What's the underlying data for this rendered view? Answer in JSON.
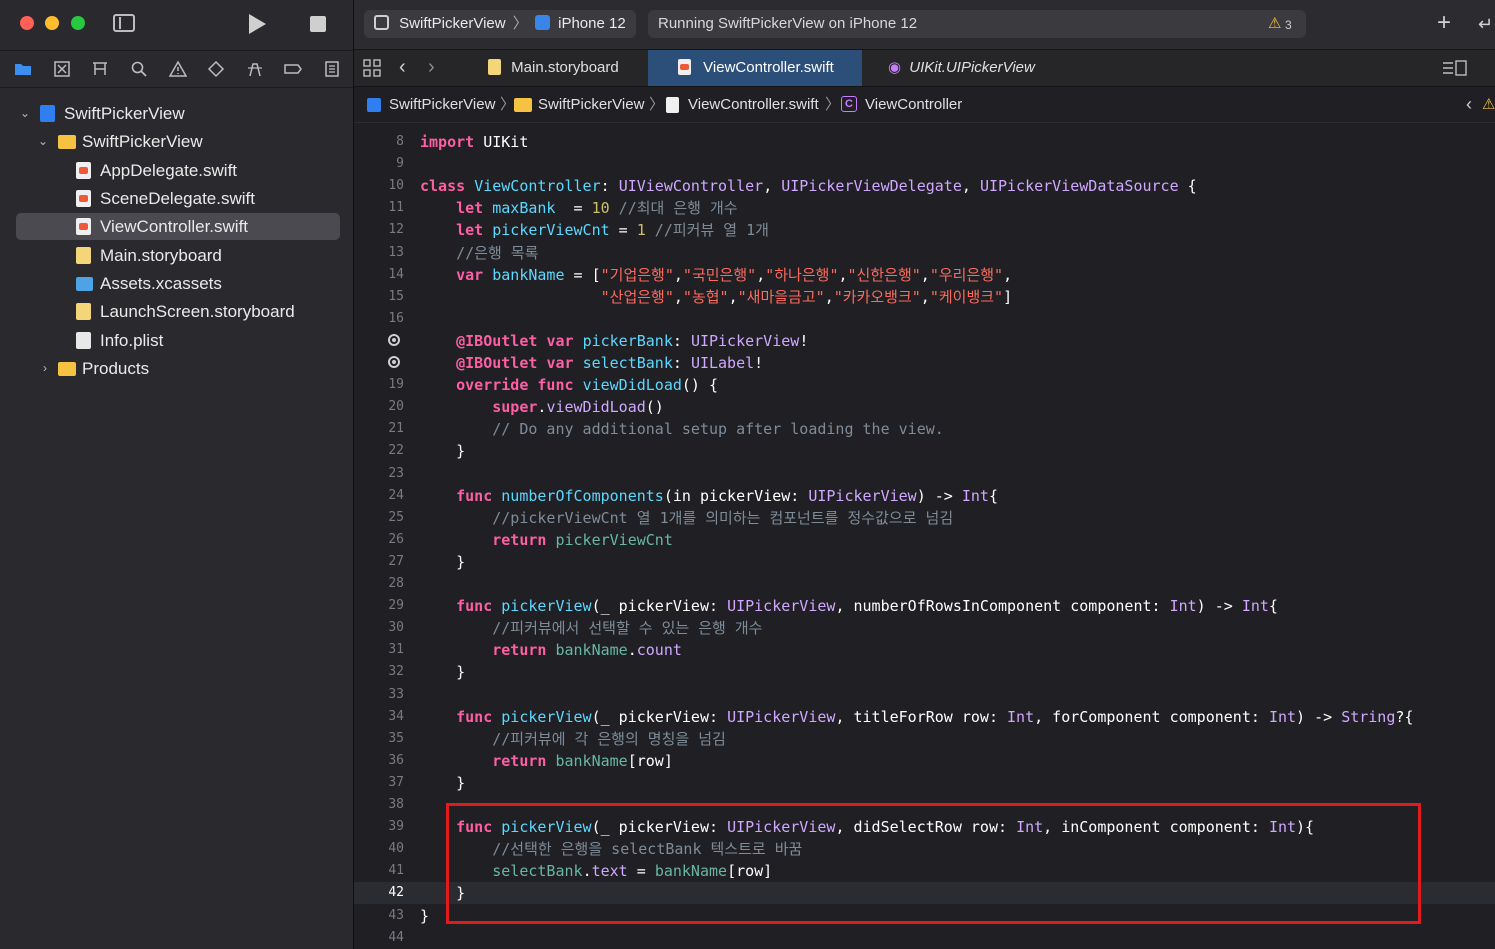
{
  "toolbar": {
    "scheme_target": "SwiftPickerView",
    "scheme_device": "iPhone 12",
    "status_text": "Running SwiftPickerView on iPhone 12",
    "warning_count": "3"
  },
  "tabs": [
    {
      "label": "Main.storyboard"
    },
    {
      "label": "ViewController.swift"
    },
    {
      "label": "UIKit.UIPickerView"
    }
  ],
  "jumpbar": {
    "project": "SwiftPickerView",
    "group": "SwiftPickerView",
    "file": "ViewController.swift",
    "symbol": "ViewController"
  },
  "navigator": {
    "project": "SwiftPickerView",
    "group": "SwiftPickerView",
    "files": [
      {
        "label": "AppDelegate.swift"
      },
      {
        "label": "SceneDelegate.swift"
      },
      {
        "label": "ViewController.swift"
      },
      {
        "label": "Main.storyboard"
      },
      {
        "label": "Assets.xcassets"
      },
      {
        "label": "LaunchScreen.storyboard"
      },
      {
        "label": "Info.plist"
      }
    ],
    "products": "Products"
  },
  "colors": {
    "keyword": "#fc5fa3",
    "type": "#d0a8ff",
    "declaration": "#5dd8ff",
    "member": "#67b7a4",
    "number": "#d0bf69",
    "string": "#fc6a5d",
    "comment": "#7f8c98",
    "highlight_box": "#e11b1b",
    "tab_active": "#2c4f7a"
  },
  "code": {
    "current_line": "42",
    "lines": [
      {
        "n": "8",
        "segments": [
          {
            "t": "import",
            "c": "kw"
          },
          {
            "t": " UIKit",
            "c": "pl"
          }
        ]
      },
      {
        "n": "9",
        "segments": []
      },
      {
        "n": "10",
        "segments": [
          {
            "t": "class",
            "c": "kw"
          },
          {
            "t": " ",
            "c": "pl"
          },
          {
            "t": "ViewController",
            "c": "dec"
          },
          {
            "t": ": ",
            "c": "pl"
          },
          {
            "t": "UIViewController",
            "c": "typ"
          },
          {
            "t": ", ",
            "c": "pl"
          },
          {
            "t": "UIPickerViewDelegate",
            "c": "typ"
          },
          {
            "t": ", ",
            "c": "pl"
          },
          {
            "t": "UIPickerViewDataSource",
            "c": "typ"
          },
          {
            "t": " {",
            "c": "pl"
          }
        ]
      },
      {
        "n": "11",
        "segments": [
          {
            "t": "    ",
            "c": "pl"
          },
          {
            "t": "let",
            "c": "kw"
          },
          {
            "t": " ",
            "c": "pl"
          },
          {
            "t": "maxBank",
            "c": "dec"
          },
          {
            "t": "  = ",
            "c": "pl"
          },
          {
            "t": "10",
            "c": "num"
          },
          {
            "t": " //최대 은행 개수",
            "c": "com"
          }
        ]
      },
      {
        "n": "12",
        "segments": [
          {
            "t": "    ",
            "c": "pl"
          },
          {
            "t": "let",
            "c": "kw"
          },
          {
            "t": " ",
            "c": "pl"
          },
          {
            "t": "pickerViewCnt",
            "c": "dec"
          },
          {
            "t": " = ",
            "c": "pl"
          },
          {
            "t": "1",
            "c": "num"
          },
          {
            "t": " //피커뷰 열 1개",
            "c": "com"
          }
        ]
      },
      {
        "n": "13",
        "segments": [
          {
            "t": "    //은행 목록",
            "c": "com"
          }
        ]
      },
      {
        "n": "14",
        "segments": [
          {
            "t": "    ",
            "c": "pl"
          },
          {
            "t": "var",
            "c": "kw"
          },
          {
            "t": " ",
            "c": "pl"
          },
          {
            "t": "bankName",
            "c": "dec"
          },
          {
            "t": " = [",
            "c": "pl"
          },
          {
            "t": "\"기업은행\"",
            "c": "str"
          },
          {
            "t": ",",
            "c": "pl"
          },
          {
            "t": "\"국민은행\"",
            "c": "str"
          },
          {
            "t": ",",
            "c": "pl"
          },
          {
            "t": "\"하나은행\"",
            "c": "str"
          },
          {
            "t": ",",
            "c": "pl"
          },
          {
            "t": "\"신한은행\"",
            "c": "str"
          },
          {
            "t": ",",
            "c": "pl"
          },
          {
            "t": "\"우리은행\"",
            "c": "str"
          },
          {
            "t": ",",
            "c": "pl"
          }
        ]
      },
      {
        "n": "15",
        "segments": [
          {
            "t": "                    ",
            "c": "pl"
          },
          {
            "t": "\"산업은행\"",
            "c": "str"
          },
          {
            "t": ",",
            "c": "pl"
          },
          {
            "t": "\"농협\"",
            "c": "str"
          },
          {
            "t": ",",
            "c": "pl"
          },
          {
            "t": "\"새마을금고\"",
            "c": "str"
          },
          {
            "t": ",",
            "c": "pl"
          },
          {
            "t": "\"카카오뱅크\"",
            "c": "str"
          },
          {
            "t": ",",
            "c": "pl"
          },
          {
            "t": "\"케이뱅크\"",
            "c": "str"
          },
          {
            "t": "]",
            "c": "pl"
          }
        ]
      },
      {
        "n": "16",
        "segments": []
      },
      {
        "n": "",
        "bp": true,
        "segments": [
          {
            "t": "    ",
            "c": "pl"
          },
          {
            "t": "@IBOutlet",
            "c": "kw"
          },
          {
            "t": " ",
            "c": "pl"
          },
          {
            "t": "var",
            "c": "kw"
          },
          {
            "t": " ",
            "c": "pl"
          },
          {
            "t": "pickerBank",
            "c": "dec"
          },
          {
            "t": ": ",
            "c": "pl"
          },
          {
            "t": "UIPickerView",
            "c": "typ"
          },
          {
            "t": "!",
            "c": "pl"
          }
        ]
      },
      {
        "n": "",
        "bp": true,
        "segments": [
          {
            "t": "    ",
            "c": "pl"
          },
          {
            "t": "@IBOutlet",
            "c": "kw"
          },
          {
            "t": " ",
            "c": "pl"
          },
          {
            "t": "var",
            "c": "kw"
          },
          {
            "t": " ",
            "c": "pl"
          },
          {
            "t": "selectBank",
            "c": "dec"
          },
          {
            "t": ": ",
            "c": "pl"
          },
          {
            "t": "UILabel",
            "c": "typ"
          },
          {
            "t": "!",
            "c": "pl"
          }
        ]
      },
      {
        "n": "19",
        "segments": [
          {
            "t": "    ",
            "c": "pl"
          },
          {
            "t": "override",
            "c": "kw"
          },
          {
            "t": " ",
            "c": "pl"
          },
          {
            "t": "func",
            "c": "kw"
          },
          {
            "t": " ",
            "c": "pl"
          },
          {
            "t": "viewDidLoad",
            "c": "dec"
          },
          {
            "t": "() {",
            "c": "pl"
          }
        ]
      },
      {
        "n": "20",
        "segments": [
          {
            "t": "        ",
            "c": "pl"
          },
          {
            "t": "super",
            "c": "kw"
          },
          {
            "t": ".",
            "c": "pl"
          },
          {
            "t": "viewDidLoad",
            "c": "typ"
          },
          {
            "t": "()",
            "c": "pl"
          }
        ]
      },
      {
        "n": "21",
        "segments": [
          {
            "t": "        // Do any additional setup after loading the view.",
            "c": "com"
          }
        ]
      },
      {
        "n": "22",
        "segments": [
          {
            "t": "    }",
            "c": "pl"
          }
        ]
      },
      {
        "n": "23",
        "segments": []
      },
      {
        "n": "24",
        "segments": [
          {
            "t": "    ",
            "c": "pl"
          },
          {
            "t": "func",
            "c": "kw"
          },
          {
            "t": " ",
            "c": "pl"
          },
          {
            "t": "numberOfComponents",
            "c": "dec"
          },
          {
            "t": "(in pickerView: ",
            "c": "pl"
          },
          {
            "t": "UIPickerView",
            "c": "typ"
          },
          {
            "t": ") -> ",
            "c": "pl"
          },
          {
            "t": "Int",
            "c": "typ"
          },
          {
            "t": "{",
            "c": "pl"
          }
        ]
      },
      {
        "n": "25",
        "segments": [
          {
            "t": "        //pickerViewCnt 열 1개를 의미하는 컴포넌트를 정수값으로 넘김",
            "c": "com"
          }
        ]
      },
      {
        "n": "26",
        "segments": [
          {
            "t": "        ",
            "c": "pl"
          },
          {
            "t": "return",
            "c": "kw"
          },
          {
            "t": " ",
            "c": "pl"
          },
          {
            "t": "pickerViewCnt",
            "c": "fn"
          }
        ]
      },
      {
        "n": "27",
        "segments": [
          {
            "t": "    }",
            "c": "pl"
          }
        ]
      },
      {
        "n": "28",
        "segments": []
      },
      {
        "n": "29",
        "segments": [
          {
            "t": "    ",
            "c": "pl"
          },
          {
            "t": "func",
            "c": "kw"
          },
          {
            "t": " ",
            "c": "pl"
          },
          {
            "t": "pickerView",
            "c": "dec"
          },
          {
            "t": "(_ pickerView: ",
            "c": "pl"
          },
          {
            "t": "UIPickerView",
            "c": "typ"
          },
          {
            "t": ", numberOfRowsInComponent component: ",
            "c": "pl"
          },
          {
            "t": "Int",
            "c": "typ"
          },
          {
            "t": ") -> ",
            "c": "pl"
          },
          {
            "t": "Int",
            "c": "typ"
          },
          {
            "t": "{",
            "c": "pl"
          }
        ]
      },
      {
        "n": "30",
        "segments": [
          {
            "t": "        //피커뷰에서 선택할 수 있는 은행 개수",
            "c": "com"
          }
        ]
      },
      {
        "n": "31",
        "segments": [
          {
            "t": "        ",
            "c": "pl"
          },
          {
            "t": "return",
            "c": "kw"
          },
          {
            "t": " ",
            "c": "pl"
          },
          {
            "t": "bankName",
            "c": "fn"
          },
          {
            "t": ".",
            "c": "pl"
          },
          {
            "t": "count",
            "c": "typ"
          }
        ]
      },
      {
        "n": "32",
        "segments": [
          {
            "t": "    }",
            "c": "pl"
          }
        ]
      },
      {
        "n": "33",
        "segments": []
      },
      {
        "n": "34",
        "segments": [
          {
            "t": "    ",
            "c": "pl"
          },
          {
            "t": "func",
            "c": "kw"
          },
          {
            "t": " ",
            "c": "pl"
          },
          {
            "t": "pickerView",
            "c": "dec"
          },
          {
            "t": "(_ pickerView: ",
            "c": "pl"
          },
          {
            "t": "UIPickerView",
            "c": "typ"
          },
          {
            "t": ", titleForRow row: ",
            "c": "pl"
          },
          {
            "t": "Int",
            "c": "typ"
          },
          {
            "t": ", forComponent component: ",
            "c": "pl"
          },
          {
            "t": "Int",
            "c": "typ"
          },
          {
            "t": ") -> ",
            "c": "pl"
          },
          {
            "t": "String",
            "c": "typ"
          },
          {
            "t": "?{",
            "c": "pl"
          }
        ]
      },
      {
        "n": "35",
        "segments": [
          {
            "t": "        //피커뷰에 각 은행의 명칭을 넘김",
            "c": "com"
          }
        ]
      },
      {
        "n": "36",
        "segments": [
          {
            "t": "        ",
            "c": "pl"
          },
          {
            "t": "return",
            "c": "kw"
          },
          {
            "t": " ",
            "c": "pl"
          },
          {
            "t": "bankName",
            "c": "fn"
          },
          {
            "t": "[row]",
            "c": "pl"
          }
        ]
      },
      {
        "n": "37",
        "segments": [
          {
            "t": "    }",
            "c": "pl"
          }
        ]
      },
      {
        "n": "38",
        "segments": []
      },
      {
        "n": "39",
        "segments": [
          {
            "t": "    ",
            "c": "pl"
          },
          {
            "t": "func",
            "c": "kw"
          },
          {
            "t": " ",
            "c": "pl"
          },
          {
            "t": "pickerView",
            "c": "dec"
          },
          {
            "t": "(_ pickerView: ",
            "c": "pl"
          },
          {
            "t": "UIPickerView",
            "c": "typ"
          },
          {
            "t": ", didSelectRow row: ",
            "c": "pl"
          },
          {
            "t": "Int",
            "c": "typ"
          },
          {
            "t": ", inComponent component: ",
            "c": "pl"
          },
          {
            "t": "Int",
            "c": "typ"
          },
          {
            "t": "){",
            "c": "pl"
          }
        ]
      },
      {
        "n": "40",
        "segments": [
          {
            "t": "        //선택한 은행을 selectBank 텍스트로 바꿈",
            "c": "com"
          }
        ]
      },
      {
        "n": "41",
        "segments": [
          {
            "t": "        ",
            "c": "pl"
          },
          {
            "t": "selectBank",
            "c": "fn"
          },
          {
            "t": ".",
            "c": "pl"
          },
          {
            "t": "text",
            "c": "typ"
          },
          {
            "t": " = ",
            "c": "pl"
          },
          {
            "t": "bankName",
            "c": "fn"
          },
          {
            "t": "[row]",
            "c": "pl"
          }
        ]
      },
      {
        "n": "42",
        "segments": [
          {
            "t": "    }",
            "c": "pl"
          }
        ]
      },
      {
        "n": "43",
        "segments": [
          {
            "t": "}",
            "c": "pl"
          }
        ]
      },
      {
        "n": "44",
        "segments": []
      }
    ]
  }
}
